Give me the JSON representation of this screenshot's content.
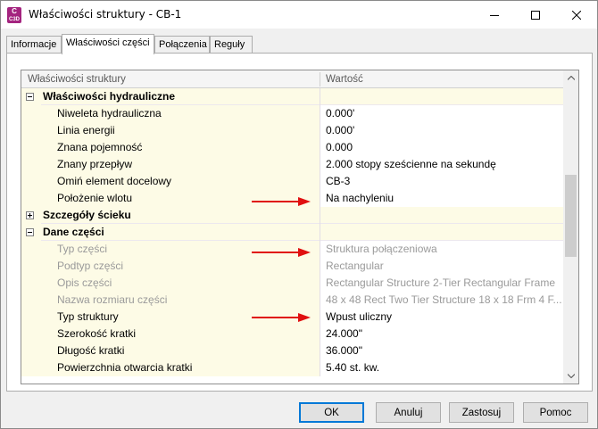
{
  "window": {
    "title": "Właściwości struktury - CB-1",
    "app_icon_letter": "C",
    "app_icon_sub": "C3D"
  },
  "tabs": [
    {
      "label": "Informacje",
      "active": false
    },
    {
      "label": "Właściwości części",
      "active": true
    },
    {
      "label": "Połączenia",
      "active": false
    },
    {
      "label": "Reguły",
      "active": false
    }
  ],
  "grid": {
    "columns": [
      "Właściwości struktury",
      "Wartość"
    ],
    "rows": [
      {
        "type": "group",
        "expanded": true,
        "name": "Właściwości hydrauliczne",
        "value": ""
      },
      {
        "type": "item",
        "name": "Niweleta hydrauliczna",
        "value": "0.000'"
      },
      {
        "type": "item",
        "name": "Linia energii",
        "value": "0.000'"
      },
      {
        "type": "item",
        "name": "Znana pojemność",
        "value": "0.000"
      },
      {
        "type": "item",
        "name": "Znany przepływ",
        "value": "2.000 stopy sześcienne na sekundę"
      },
      {
        "type": "item",
        "name": "Omiń element docelowy",
        "value": "CB-3"
      },
      {
        "type": "item",
        "name": "Położenie wlotu",
        "value": "Na nachyleniu",
        "arrow": true
      },
      {
        "type": "group",
        "expanded": false,
        "name": "Szczegóły ścieku",
        "value": ""
      },
      {
        "type": "group",
        "expanded": true,
        "name": "Dane części",
        "value": ""
      },
      {
        "type": "item",
        "disabled": true,
        "name": "Typ części",
        "value": "Struktura połączeniowa",
        "arrow": true
      },
      {
        "type": "item",
        "disabled": true,
        "name": "Podtyp części",
        "value": "Rectangular"
      },
      {
        "type": "item",
        "disabled": true,
        "name": "Opis części",
        "value": "Rectangular Structure 2-Tier Rectangular Frame"
      },
      {
        "type": "item",
        "disabled": true,
        "name": "Nazwa rozmiaru części",
        "value": "48 x 48 Rect Two Tier Structure 18 x 18 Frm 4 F..."
      },
      {
        "type": "item",
        "name": "Typ struktury",
        "value": "Wpust uliczny",
        "arrow": true
      },
      {
        "type": "item",
        "name": "Szerokość kratki",
        "value": "24.000\""
      },
      {
        "type": "item",
        "name": "Długość kratki",
        "value": "36.000\""
      },
      {
        "type": "item",
        "name": "Powierzchnia otwarcia kratki",
        "value": "5.40 st. kw."
      }
    ]
  },
  "buttons": {
    "ok": "OK",
    "cancel": "Anuluj",
    "apply": "Zastosuj",
    "help": "Pomoc"
  },
  "colors": {
    "arrow": "#e01010",
    "row_bg": "#fdfbe6",
    "accent": "#0078d7"
  }
}
